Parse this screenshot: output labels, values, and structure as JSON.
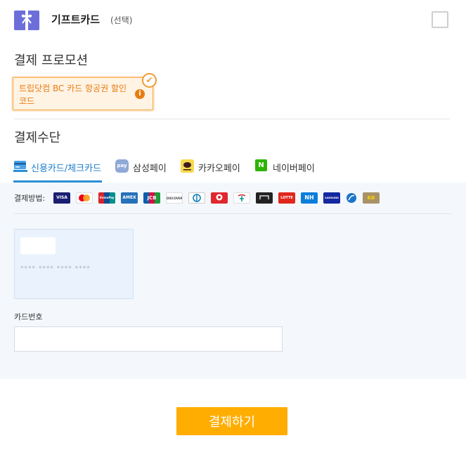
{
  "gift": {
    "title": "기프트카드",
    "subtitle": "(선택)",
    "icon": "gift-card-icon",
    "icon_color": "#6c6fd9"
  },
  "promotion": {
    "title": "결제 프로모션",
    "coupon_text": "트립닷컴 BC 카드 항공권 할인코드",
    "info_glyph": "i",
    "check_glyph": "✔"
  },
  "payment": {
    "title": "결제수단",
    "tabs": [
      {
        "label": "신용카드/체크카드",
        "icon": "credit-card-icon",
        "active": true
      },
      {
        "label": "삼성페이",
        "icon": "samsung-pay-icon",
        "icon_text": "pay"
      },
      {
        "label": "카카오페이",
        "icon": "kakao-pay-icon"
      },
      {
        "label": "네이버페이",
        "icon": "naver-pay-icon",
        "icon_text": "N"
      }
    ],
    "methods_label": "결제방법:",
    "card_logos": [
      {
        "name": "visa",
        "text": "VISA",
        "color": "#1a1f71"
      },
      {
        "name": "mastercard",
        "text": "",
        "color": "#ffffff"
      },
      {
        "name": "unionpay",
        "text": "UnionPay",
        "color": "#d8232a"
      },
      {
        "name": "amex",
        "text": "AMEX",
        "color": "#2671b9"
      },
      {
        "name": "jcb",
        "text": "JCB",
        "color": "#0b5faa"
      },
      {
        "name": "discover",
        "text": "DISCOVER",
        "color": "#ffffff"
      },
      {
        "name": "diners",
        "text": "",
        "color": "#ffffff"
      },
      {
        "name": "card-8",
        "text": "",
        "color": "#e0282e"
      },
      {
        "name": "card-9",
        "text": "",
        "color": "#ffffff"
      },
      {
        "name": "card-10",
        "text": "",
        "color": "#222222"
      },
      {
        "name": "lotte",
        "text": "LOTTE",
        "color": "#e1261c"
      },
      {
        "name": "nh",
        "text": "NH",
        "color": "#0a7ddb"
      },
      {
        "name": "samsung",
        "text": "SAMSUNG",
        "color": "#1428a0"
      },
      {
        "name": "card-14",
        "text": "",
        "color": "#1b74c5"
      },
      {
        "name": "kb",
        "text": "KB",
        "color": "#a99268"
      }
    ],
    "card_mask": "**** **** **** ****",
    "card_number_label": "카드번호",
    "card_number_value": ""
  },
  "submit_label": "결제하기"
}
